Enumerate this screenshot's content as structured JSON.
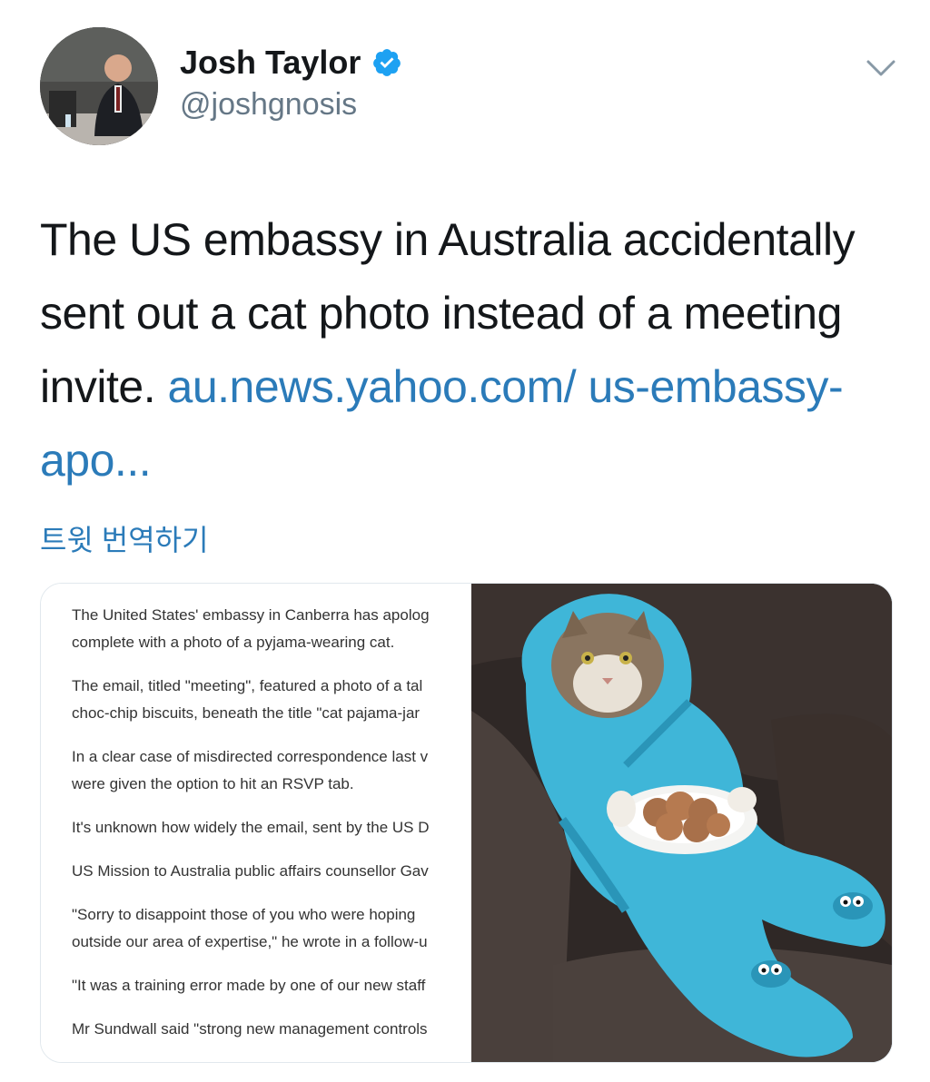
{
  "tweet": {
    "author": {
      "display_name": "Josh Taylor",
      "handle": "@joshgnosis",
      "verified": true,
      "avatar_icon": "profile-photo"
    },
    "menu_icon": "chevron-down-icon",
    "text_plain": "The US embassy in Australia accidentally sent out a cat photo instead of a meeting invite. ",
    "link_text": "au.news.yahoo.com/ us-embassy-apo...",
    "translate_label": "트윗 번역하기",
    "colors": {
      "text": "#14171a",
      "secondary": "#657786",
      "link": "#2b7bb9",
      "verified": "#1da1f2"
    }
  },
  "media": {
    "article_paragraphs": [
      {
        "line1": "The United States' embassy in Canberra has apolog",
        "line2": "complete with a photo of a pyjama-wearing cat."
      },
      {
        "line1": "The email, titled \"meeting\", featured a photo of a tal",
        "line2": "choc-chip biscuits, beneath the title \"cat pajama-jar"
      },
      {
        "line1": "In a clear case of misdirected correspondence last v",
        "line2": "were given the option to hit an RSVP tab."
      },
      {
        "line1": "It's unknown how widely the email, sent by the US D",
        "line2": ""
      },
      {
        "line1": "US Mission to Australia public affairs counsellor Gav",
        "line2": ""
      },
      {
        "line1": "\"Sorry to disappoint those of you who were hoping",
        "line2": "outside our area of expertise,\" he wrote in a follow-u"
      },
      {
        "line1": "\"It was a training error made by one of our new staff",
        "line2": ""
      },
      {
        "line1": "Mr Sundwall said \"strong new management controls",
        "line2": ""
      }
    ],
    "photo_icon": "cat-in-pajamas-photo"
  }
}
